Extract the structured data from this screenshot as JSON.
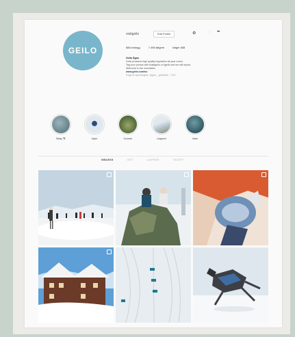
{
  "profile": {
    "avatar_text": "GEILO",
    "username": "visitgeilo",
    "edit_label": "Edit Profile",
    "stats": {
      "posts": "886 innlegg",
      "followers": "7 496 følgere",
      "following": "følger 838"
    },
    "bio": {
      "name": "Geilo Ågos",
      "lines": [
        "Geilo presents high quality inspiration all year round.",
        "Tag your photos with #visitgeilo or #geilo and we will repost.",
        "Welcome to the mountains."
      ],
      "link": "www.geilo.com/no",
      "followed_by": "Fulgt av sportsrights, sigam_, geilofest, + 123"
    }
  },
  "highlights": [
    {
      "label": "Skiløp ⛷",
      "color": "#4f6f76"
    },
    {
      "label": "Alpint",
      "color": "#dfe8ee"
    },
    {
      "label": "Sommer",
      "color": "#58733d"
    },
    {
      "label": "Langrenn",
      "color": "#c6d7df"
    },
    {
      "label": "Vinter",
      "color": "#1f4f5c"
    }
  ],
  "tabs": [
    "INNLEGG",
    "IGTV",
    "LAGREDE",
    "TAGGET"
  ],
  "posts": [
    {
      "name": "skiers-on-snow"
    },
    {
      "name": "group-on-rock"
    },
    {
      "name": "child-with-goggles"
    },
    {
      "name": "wooden-lodge-in-snow"
    },
    {
      "name": "aerial-ski-tracks"
    },
    {
      "name": "dog-in-snow"
    }
  ],
  "colors": {
    "avatar": "#79b6cb",
    "background": "#c8d3cb",
    "link": "#1b3d66"
  }
}
